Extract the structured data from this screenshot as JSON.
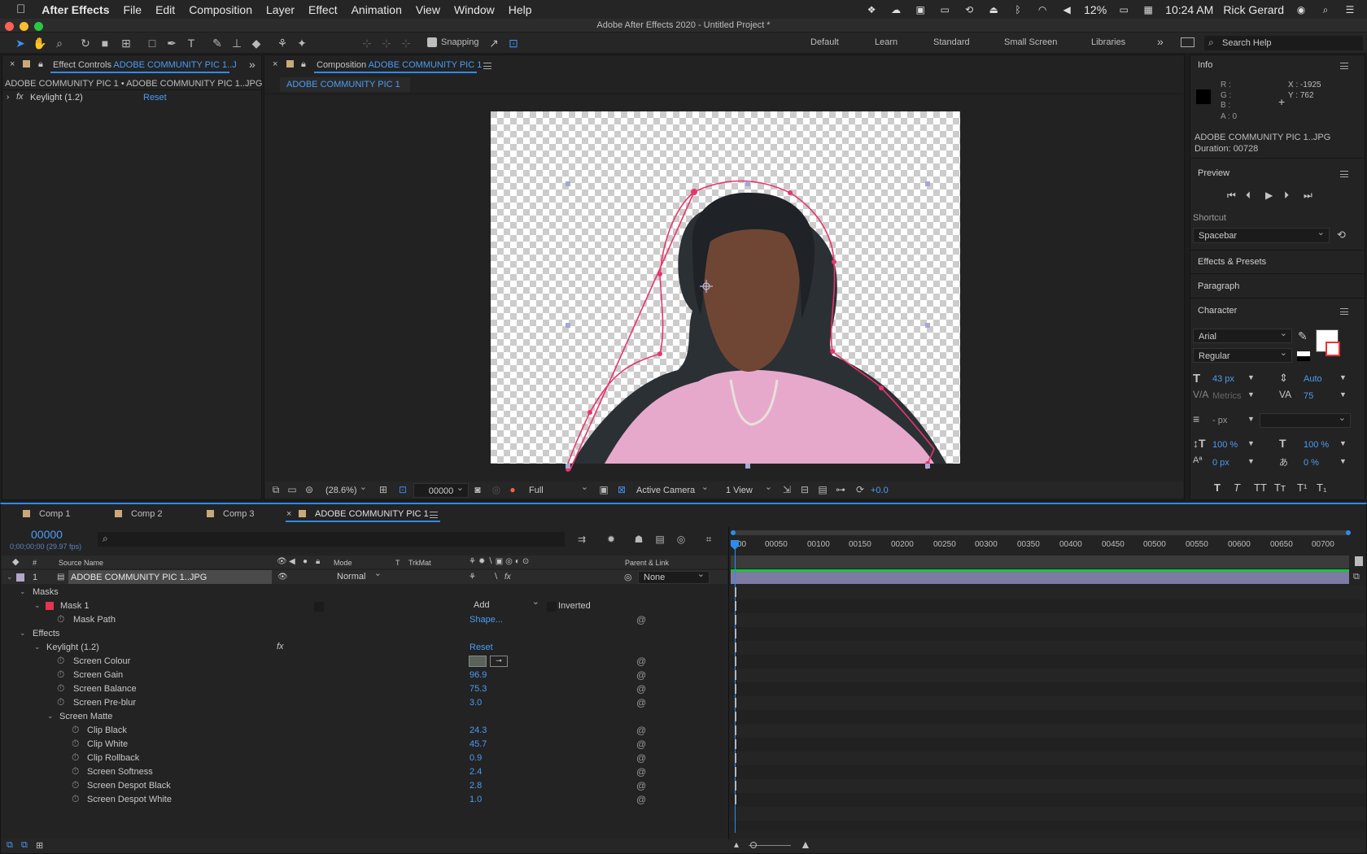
{
  "menubar": {
    "apple": "",
    "app_name": "After Effects",
    "items": [
      "File",
      "Edit",
      "Composition",
      "Layer",
      "Effect",
      "Animation",
      "View",
      "Window",
      "Help"
    ],
    "battery": "12%",
    "time": "10:24 AM",
    "user": "Rick Gerard"
  },
  "window_title": "Adobe After Effects 2020 - Untitled Project *",
  "toolbar": {
    "snapping_label": "Snapping",
    "workspaces": [
      "Default",
      "Learn",
      "Standard",
      "Small Screen",
      "Libraries"
    ],
    "search_placeholder": "Search Help"
  },
  "effect_controls": {
    "tab_prefix": "Effect Controls",
    "tab_layer": "ADOBE COMMUNITY PIC 1..J",
    "breadcrumb": "ADOBE COMMUNITY PIC 1 • ADOBE COMMUNITY PIC 1..JPG",
    "effect_name": "Keylight (1.2)",
    "reset_label": "Reset"
  },
  "composition": {
    "tab_prefix": "Composition",
    "tab_name": "ADOBE COMMUNITY PIC 1",
    "sub_tab": "ADOBE COMMUNITY PIC 1",
    "footer": {
      "zoom": "(28.6%)",
      "timecode": "00000",
      "resolution": "Full",
      "camera": "Active Camera",
      "views": "1 View",
      "exposure": "+0.0"
    }
  },
  "info": {
    "title": "Info",
    "r": "R :",
    "g": "G :",
    "b": "B :",
    "a": "A :  0",
    "x": "X : -1925",
    "y": "Y : 762",
    "file": "ADOBE COMMUNITY PIC 1..JPG",
    "duration": "Duration: 00728"
  },
  "preview": {
    "title": "Preview",
    "shortcut_label": "Shortcut",
    "shortcut_value": "Spacebar"
  },
  "collapsed_panels": [
    "Effects & Presets",
    "Paragraph"
  ],
  "character": {
    "title": "Character",
    "font": "Arial",
    "style": "Regular",
    "size": "43 px",
    "leading": "Auto",
    "kerning": "Metrics",
    "tracking": "75",
    "stroke_width": "- px",
    "vscale": "100 %",
    "hscale": "100 %",
    "baseline": "0 px",
    "tsume": "0 %",
    "type_buttons": [
      "T",
      "T",
      "TT",
      "Tт",
      "T¹",
      "T₁"
    ]
  },
  "timeline": {
    "tabs": [
      "Comp 1",
      "Comp 2",
      "Comp 3",
      "ADOBE COMMUNITY PIC 1"
    ],
    "tab_colors": [
      "#c8a97a",
      "#c8a97a",
      "#c8a97a",
      "#c8a97a"
    ],
    "timecode": "00000",
    "timecode_sub": "0;00;00;00 (29.97 fps)",
    "columns": {
      "num": "#",
      "source": "Source Name",
      "mode": "Mode",
      "t": "T",
      "trkmat": "TrkMat",
      "parent": "Parent & Link"
    },
    "layer": {
      "num": "1",
      "name": "ADOBE COMMUNITY PIC 1..JPG",
      "mode": "Normal",
      "parent": "None"
    },
    "masks_label": "Masks",
    "mask1": {
      "name": "Mask 1",
      "mode": "Add",
      "inverted": "Inverted"
    },
    "mask_path": {
      "name": "Mask Path",
      "value": "Shape..."
    },
    "effects_label": "Effects",
    "keylight": {
      "name": "Keylight (1.2)",
      "reset": "Reset"
    },
    "properties": [
      {
        "name": "Screen Colour",
        "value": ""
      },
      {
        "name": "Screen Gain",
        "value": "96.9"
      },
      {
        "name": "Screen Balance",
        "value": "75.3"
      },
      {
        "name": "Screen Pre-blur",
        "value": "3.0"
      }
    ],
    "screen_matte": {
      "name": "Screen Matte"
    },
    "matte_properties": [
      {
        "name": "Clip Black",
        "value": "24.3"
      },
      {
        "name": "Clip White",
        "value": "45.7"
      },
      {
        "name": "Clip Rollback",
        "value": "0.9"
      },
      {
        "name": "Screen Softness",
        "value": "2.4"
      },
      {
        "name": "Screen Despot Black",
        "value": "2.8"
      },
      {
        "name": "Screen Despot White",
        "value": "1.0"
      }
    ],
    "ruler": [
      "00050",
      "00100",
      "00150",
      "00200",
      "00250",
      "00300",
      "00350",
      "00400",
      "00450",
      "00500",
      "00550",
      "00600",
      "00650",
      "00700"
    ],
    "ruler_first": "00"
  }
}
